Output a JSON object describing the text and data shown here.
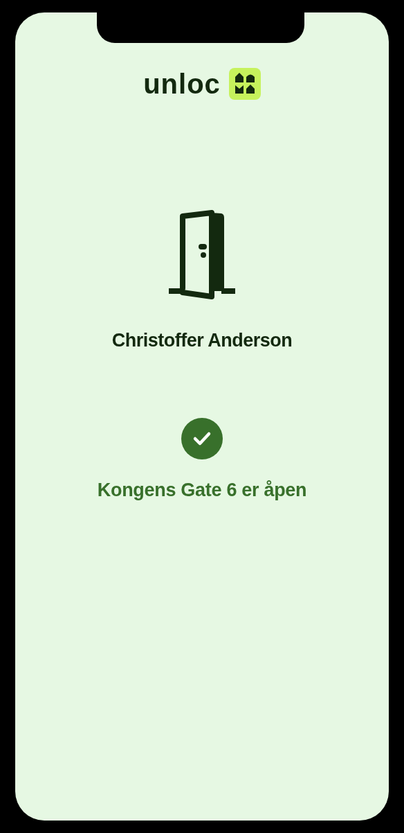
{
  "logo": {
    "text": "unloc"
  },
  "user": {
    "name": "Christoffer Anderson"
  },
  "status": {
    "kind": "success",
    "text": "Kongens Gate 6 er åpen"
  }
}
